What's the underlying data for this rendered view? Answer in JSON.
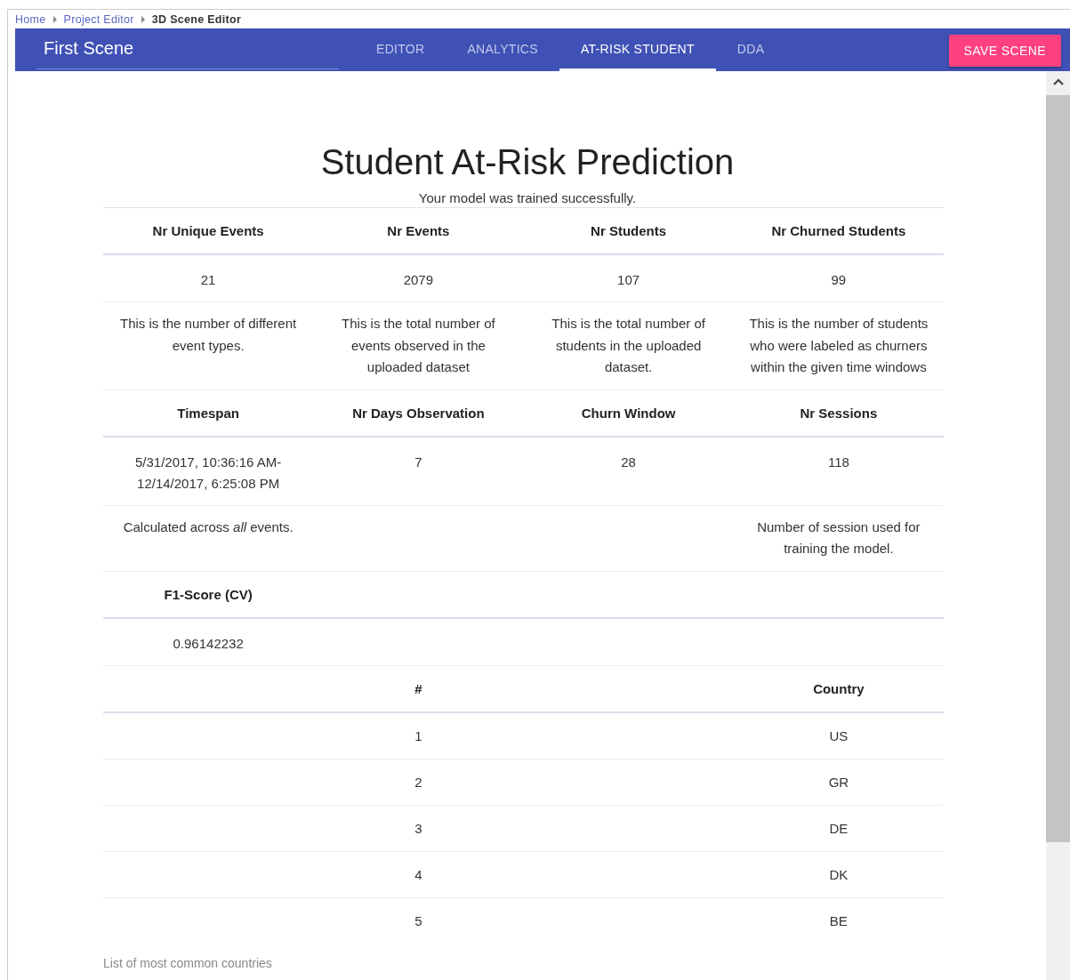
{
  "breadcrumb": [
    {
      "label": "Home",
      "current": false
    },
    {
      "label": "Project Editor",
      "current": false
    },
    {
      "label": "3D Scene Editor",
      "current": true
    }
  ],
  "header": {
    "scene_name": "First Scene",
    "tabs": [
      {
        "label": "EDITOR",
        "selected": false
      },
      {
        "label": "ANALYTICS",
        "selected": false
      },
      {
        "label": "AT-RISK STUDENT",
        "selected": true
      },
      {
        "label": "DDA",
        "selected": false
      }
    ],
    "save_button": "SAVE SCENE"
  },
  "page": {
    "title": "Student At-Risk Prediction",
    "status": "Your model was trained successfully.",
    "stats_rows": [
      {
        "kind": "header",
        "cells": [
          "Nr Unique Events",
          "Nr Events",
          "Nr Students",
          "Nr Churned Students"
        ]
      },
      {
        "kind": "value",
        "cells": [
          "21",
          "2079",
          "107",
          "99"
        ]
      },
      {
        "kind": "note",
        "cells": [
          "This is the number of different event types.",
          "This is the total number of events observed in the uploaded dataset",
          "This is the total number of students in the uploaded dataset.",
          "This is the number of students who were labeled as churners within the given time windows"
        ]
      },
      {
        "kind": "header",
        "cells": [
          "Timespan",
          "Nr Days Observation",
          "Churn Window",
          "Nr Sessions"
        ]
      },
      {
        "kind": "value",
        "cells": [
          "5/31/2017, 10:36:16 AM-12/14/2017, 6:25:08 PM",
          "7",
          "28",
          "118"
        ]
      },
      {
        "kind": "note",
        "cells": [
          "Calculated across *all* events.",
          null,
          null,
          "Number of session used for training the model."
        ]
      },
      {
        "kind": "header",
        "cells": [
          "F1-Score (CV)",
          null,
          null,
          null
        ]
      },
      {
        "kind": "value",
        "cells": [
          "0.96142232",
          null,
          null,
          null
        ]
      }
    ],
    "countries": {
      "columns": [
        "#",
        "Country"
      ],
      "rows": [
        [
          "1",
          "US"
        ],
        [
          "2",
          "GR"
        ],
        [
          "3",
          "DE"
        ],
        [
          "4",
          "DK"
        ],
        [
          "5",
          "BE"
        ]
      ],
      "caption": "List of most common countries"
    }
  }
}
